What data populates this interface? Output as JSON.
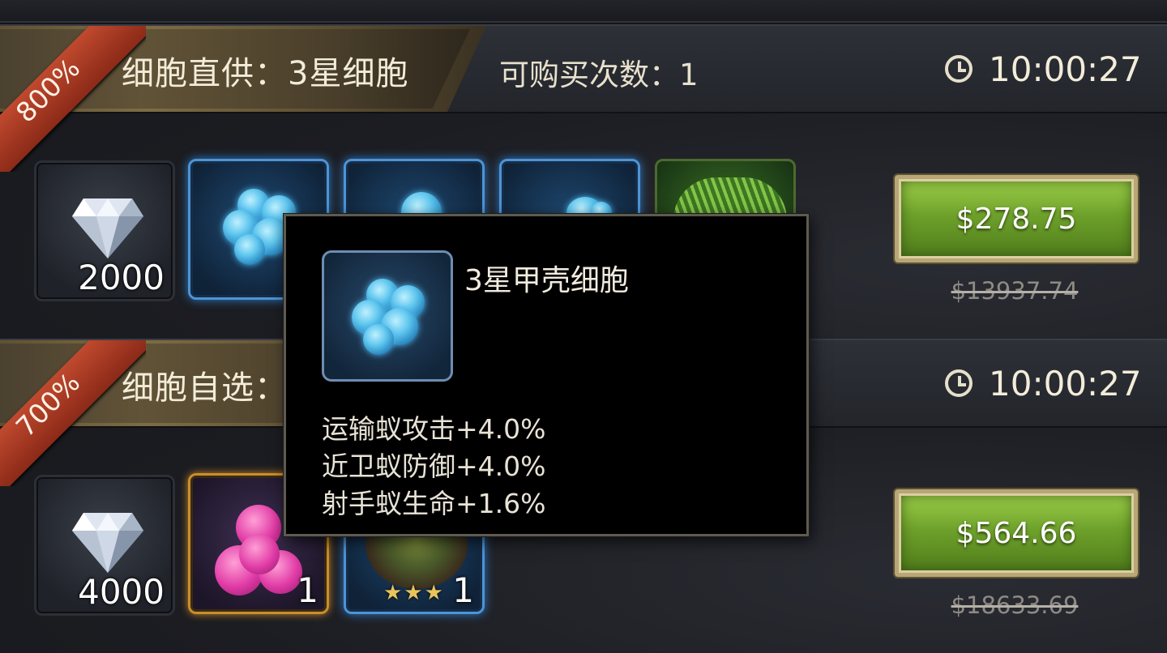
{
  "packs": [
    {
      "discount": "800%",
      "title": "细胞直供：3星细胞",
      "limit": "可购买次数：1",
      "timer": "10:00:27",
      "items": [
        {
          "type": "diamond",
          "qty": "2000"
        },
        {
          "type": "blue-cell"
        },
        {
          "type": "blue-cell"
        },
        {
          "type": "blue-cell"
        },
        {
          "type": "fern"
        }
      ],
      "price": "$278.75",
      "original_price": "$13937.74"
    },
    {
      "discount": "700%",
      "title": "细胞自选：",
      "timer": "10:00:27",
      "items": [
        {
          "type": "diamond",
          "qty": "4000"
        },
        {
          "type": "pink-cell",
          "qty": "1"
        },
        {
          "type": "nest",
          "qty": "1",
          "stars": "★★★"
        }
      ],
      "price": "$564.66",
      "original_price": "$18633.69"
    }
  ],
  "tooltip": {
    "name": "3星甲壳细胞",
    "stats": [
      "运输蚁攻击+4.0%",
      "近卫蚁防御+4.0%",
      "射手蚁生命+1.6%"
    ]
  },
  "colors": {
    "buy_button": "#7cb232",
    "discount_ribbon": "#b5432a",
    "slot_blue": "#4d94d6",
    "slot_gold": "#c98f2a"
  }
}
